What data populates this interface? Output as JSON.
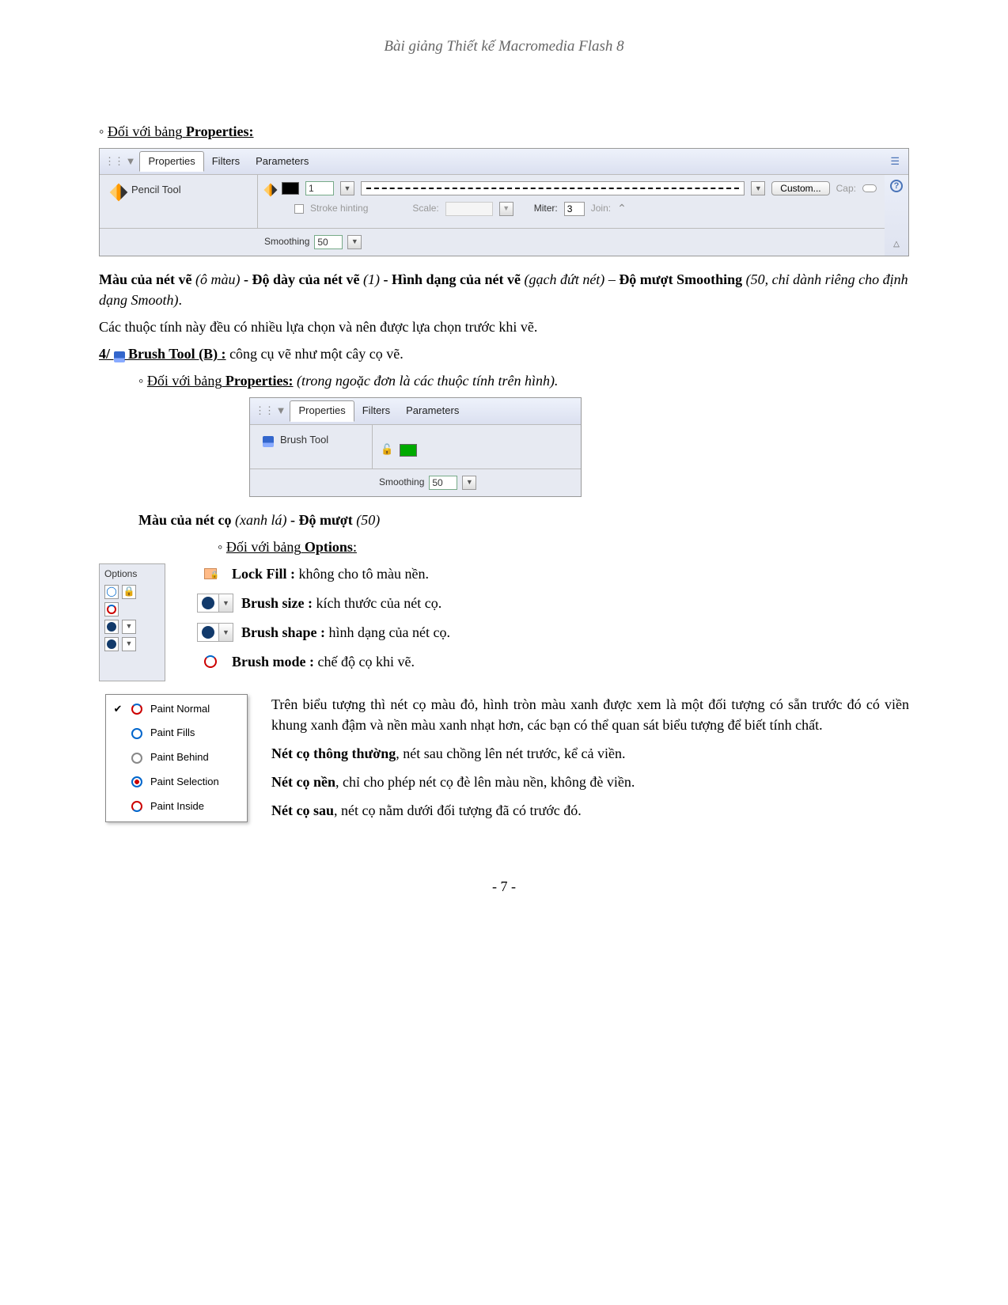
{
  "doc": {
    "header": "Bài giảng Thiết kế Macromedia Flash 8",
    "page_num": "- 7 -"
  },
  "s1": {
    "intro_prefix": "◦ ",
    "intro_under": "Đối với bảng",
    "intro_bold": " Properties:"
  },
  "panel1": {
    "tabs": {
      "properties": "Properties",
      "filters": "Filters",
      "parameters": "Parameters"
    },
    "tool_name": "Pencil Tool",
    "stroke_width": "1",
    "custom": "Custom...",
    "cap": "Cap:",
    "stroke_hinting": "Stroke hinting",
    "scale": "Scale:",
    "miter_label": "Miter:",
    "miter_value": "3",
    "join": "Join:",
    "smoothing_label": "Smoothing",
    "smoothing_value": "50"
  },
  "desc1": {
    "a": "Màu của nét vẽ ",
    "b": "(ô màu)",
    "c": " - Độ dày của nét vẽ ",
    "d": "(1)",
    "e": " - Hình dạng của nét vẽ ",
    "f": "(gạch đứt nét)",
    "g": " – ",
    "h": "Độ mượt Smoothing ",
    "i": "(50, chỉ dành riêng cho định dạng Smooth)",
    "j": ".",
    "line2": "Các thuộc tính này đều có nhiều lựa chọn và nên được lựa chọn trước khi vẽ."
  },
  "s2": {
    "num": "4/ ",
    "title": "  Brush Tool (B) :",
    "rest": " công cụ vẽ như một cây cọ vẽ.",
    "sub_prefix": "◦ ",
    "sub_under": "Đối với bảng",
    "sub_bold": " Properties:",
    "sub_italic": " (trong ngoặc đơn là các thuộc tính trên hình)."
  },
  "panel2": {
    "tabs": {
      "properties": "Properties",
      "filters": "Filters",
      "parameters": "Parameters"
    },
    "tool_name": "Brush Tool",
    "smoothing_label": "Smoothing",
    "smoothing_value": "50"
  },
  "desc2": {
    "a": "Màu của nét cọ ",
    "b": "(xanh lá)",
    "c": " - Độ mượt ",
    "d": "(50)"
  },
  "s3": {
    "prefix": "◦ ",
    "under": "Đối với bảng",
    "bold": " Options",
    "colon": ":"
  },
  "options_panel": {
    "title": "Options"
  },
  "option_items": {
    "lock_fill": {
      "label": "Lock Fill :",
      "desc": " không cho tô màu nền."
    },
    "brush_size": {
      "label": "Brush size :",
      "desc": " kích thước của nét cọ."
    },
    "brush_shape": {
      "label": "Brush shape :",
      "desc": " hình dạng của nét cọ."
    },
    "brush_mode": {
      "label": "Brush mode :",
      "desc": "  chế độ cọ khi vẽ."
    }
  },
  "brush_menu": {
    "items": [
      {
        "label": "Paint Normal",
        "checked": true
      },
      {
        "label": "Paint Fills",
        "checked": false
      },
      {
        "label": "Paint Behind",
        "checked": false
      },
      {
        "label": "Paint Selection",
        "checked": false
      },
      {
        "label": "Paint Inside",
        "checked": false
      }
    ]
  },
  "mode_desc": {
    "p1": "Trên biểu tượng thì nét cọ màu đỏ, hình tròn màu xanh được xem là một đối tượng có sẵn trước đó có viền khung xanh đậm và nền màu xanh nhạt hơn, các bạn có thể quan sát biểu tượng để biết tính chất.",
    "p2a": "Nét cọ thông thường",
    "p2b": ", nét sau chồng lên nét trước, kể cả viền.",
    "p3a": "Nét cọ nền",
    "p3b": ", chỉ cho phép nét cọ đè lên màu nền, không đè viền.",
    "p4a": "Nét cọ sau",
    "p4b": ", nét cọ nằm dưới đối tượng đã có trước đó."
  }
}
